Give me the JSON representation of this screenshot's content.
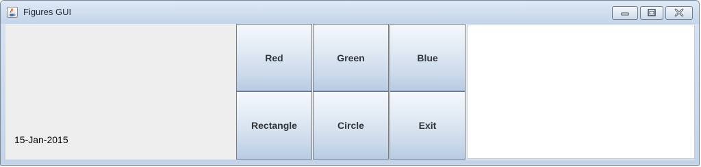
{
  "window": {
    "title": "Figures GUI"
  },
  "left_panel": {
    "date": "15-Jan-2015"
  },
  "buttons": {
    "row1": [
      "Red",
      "Green",
      "Blue"
    ],
    "row2": [
      "Rectangle",
      "Circle",
      "Exit"
    ]
  },
  "colors": {
    "titlebar": "#cfddee",
    "panel_background": "#eeeeee",
    "canvas_background": "#ffffff",
    "button_border": "#6d7f95"
  },
  "icons": {
    "app": "java-cup-icon",
    "minimize": "minimize-icon",
    "maximize": "maximize-icon",
    "close": "close-icon"
  }
}
